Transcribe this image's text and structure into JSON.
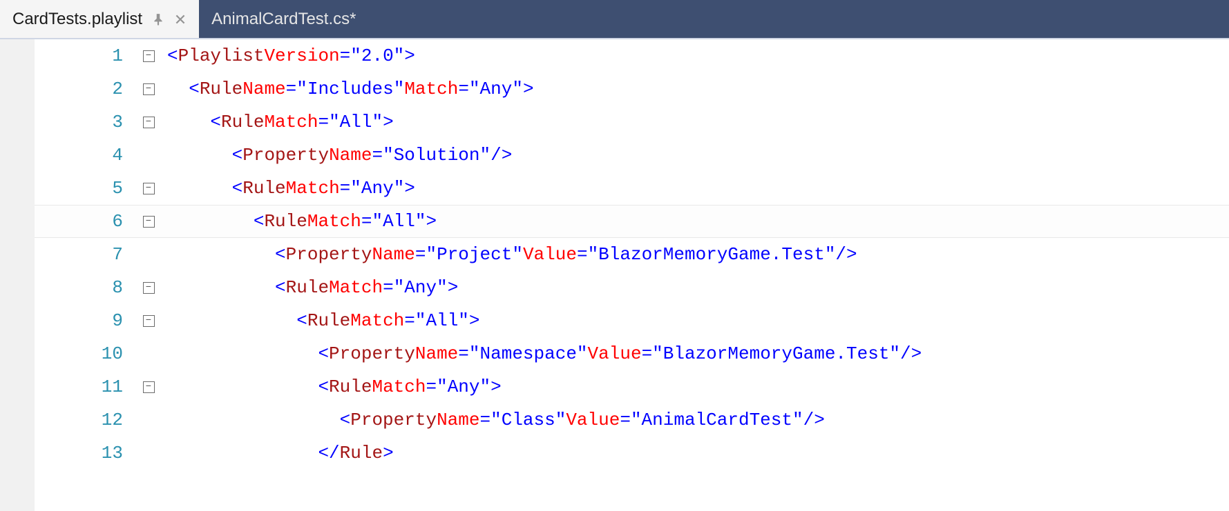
{
  "tabs": [
    {
      "label": "CardTests.playlist",
      "active": true,
      "pinned": false,
      "closeable": true
    },
    {
      "label": "AnimalCardTest.cs*",
      "active": false,
      "pinned": false,
      "closeable": false
    }
  ],
  "current_line": 6,
  "code": [
    {
      "num": 1,
      "fold": "box",
      "indent": 0,
      "tokens": [
        [
          "punc",
          "<"
        ],
        [
          "tag",
          "Playlist"
        ],
        [
          "sp",
          " "
        ],
        [
          "attr",
          "Version"
        ],
        [
          "eq",
          "="
        ],
        [
          "str",
          "\"2.0\""
        ],
        [
          "punc",
          ">"
        ]
      ]
    },
    {
      "num": 2,
      "fold": "box",
      "indent": 1,
      "tokens": [
        [
          "punc",
          "<"
        ],
        [
          "tag",
          "Rule"
        ],
        [
          "sp",
          " "
        ],
        [
          "attr",
          "Name"
        ],
        [
          "eq",
          "="
        ],
        [
          "str",
          "\"Includes\""
        ],
        [
          "sp",
          " "
        ],
        [
          "attr",
          "Match"
        ],
        [
          "eq",
          "="
        ],
        [
          "str",
          "\"Any\""
        ],
        [
          "punc",
          ">"
        ]
      ]
    },
    {
      "num": 3,
      "fold": "box",
      "indent": 2,
      "tokens": [
        [
          "punc",
          "<"
        ],
        [
          "tag",
          "Rule"
        ],
        [
          "sp",
          " "
        ],
        [
          "attr",
          "Match"
        ],
        [
          "eq",
          "="
        ],
        [
          "str",
          "\"All\""
        ],
        [
          "punc",
          ">"
        ]
      ]
    },
    {
      "num": 4,
      "fold": "line",
      "indent": 3,
      "tokens": [
        [
          "punc",
          "<"
        ],
        [
          "tag",
          "Property"
        ],
        [
          "sp",
          " "
        ],
        [
          "attr",
          "Name"
        ],
        [
          "eq",
          "="
        ],
        [
          "str",
          "\"Solution\""
        ],
        [
          "sp",
          " "
        ],
        [
          "slash",
          "/"
        ],
        [
          "punc",
          ">"
        ]
      ]
    },
    {
      "num": 5,
      "fold": "box",
      "indent": 3,
      "tokens": [
        [
          "punc",
          "<"
        ],
        [
          "tag",
          "Rule"
        ],
        [
          "sp",
          " "
        ],
        [
          "attr",
          "Match"
        ],
        [
          "eq",
          "="
        ],
        [
          "str",
          "\"Any\""
        ],
        [
          "punc",
          ">"
        ]
      ]
    },
    {
      "num": 6,
      "fold": "box",
      "indent": 4,
      "tokens": [
        [
          "punc",
          "<"
        ],
        [
          "tag",
          "Rule"
        ],
        [
          "sp",
          " "
        ],
        [
          "attr",
          "Match"
        ],
        [
          "eq",
          "="
        ],
        [
          "str",
          "\"All\""
        ],
        [
          "punc",
          ">"
        ]
      ]
    },
    {
      "num": 7,
      "fold": "line",
      "indent": 5,
      "tokens": [
        [
          "punc",
          "<"
        ],
        [
          "tag",
          "Property"
        ],
        [
          "sp",
          " "
        ],
        [
          "attr",
          "Name"
        ],
        [
          "eq",
          "="
        ],
        [
          "str",
          "\"Project\""
        ],
        [
          "sp",
          " "
        ],
        [
          "attr",
          "Value"
        ],
        [
          "eq",
          "="
        ],
        [
          "str",
          "\"BlazorMemoryGame.Test\""
        ],
        [
          "sp",
          " "
        ],
        [
          "slash",
          "/"
        ],
        [
          "punc",
          ">"
        ]
      ]
    },
    {
      "num": 8,
      "fold": "box",
      "indent": 5,
      "tokens": [
        [
          "punc",
          "<"
        ],
        [
          "tag",
          "Rule"
        ],
        [
          "sp",
          " "
        ],
        [
          "attr",
          "Match"
        ],
        [
          "eq",
          "="
        ],
        [
          "str",
          "\"Any\""
        ],
        [
          "punc",
          ">"
        ]
      ]
    },
    {
      "num": 9,
      "fold": "box",
      "indent": 6,
      "tokens": [
        [
          "punc",
          "<"
        ],
        [
          "tag",
          "Rule"
        ],
        [
          "sp",
          " "
        ],
        [
          "attr",
          "Match"
        ],
        [
          "eq",
          "="
        ],
        [
          "str",
          "\"All\""
        ],
        [
          "punc",
          ">"
        ]
      ]
    },
    {
      "num": 10,
      "fold": "line",
      "indent": 7,
      "tokens": [
        [
          "punc",
          "<"
        ],
        [
          "tag",
          "Property"
        ],
        [
          "sp",
          " "
        ],
        [
          "attr",
          "Name"
        ],
        [
          "eq",
          "="
        ],
        [
          "str",
          "\"Namespace\""
        ],
        [
          "sp",
          " "
        ],
        [
          "attr",
          "Value"
        ],
        [
          "eq",
          "="
        ],
        [
          "str",
          "\"BlazorMemoryGame.Test\""
        ],
        [
          "sp",
          " "
        ],
        [
          "slash",
          "/"
        ],
        [
          "punc",
          ">"
        ]
      ]
    },
    {
      "num": 11,
      "fold": "box",
      "indent": 7,
      "tokens": [
        [
          "punc",
          "<"
        ],
        [
          "tag",
          "Rule"
        ],
        [
          "sp",
          " "
        ],
        [
          "attr",
          "Match"
        ],
        [
          "eq",
          "="
        ],
        [
          "str",
          "\"Any\""
        ],
        [
          "punc",
          ">"
        ]
      ]
    },
    {
      "num": 12,
      "fold": "line",
      "indent": 8,
      "tokens": [
        [
          "punc",
          "<"
        ],
        [
          "tag",
          "Property"
        ],
        [
          "sp",
          " "
        ],
        [
          "attr",
          "Name"
        ],
        [
          "eq",
          "="
        ],
        [
          "str",
          "\"Class\""
        ],
        [
          "sp",
          " "
        ],
        [
          "attr",
          "Value"
        ],
        [
          "eq",
          "="
        ],
        [
          "str",
          "\"AnimalCardTest\""
        ],
        [
          "sp",
          " "
        ],
        [
          "slash",
          "/"
        ],
        [
          "punc",
          ">"
        ]
      ]
    },
    {
      "num": 13,
      "fold": "line",
      "indent": 7,
      "tokens": [
        [
          "punc",
          "</"
        ],
        [
          "tag",
          "Rule"
        ],
        [
          "punc",
          ">"
        ]
      ]
    }
  ]
}
